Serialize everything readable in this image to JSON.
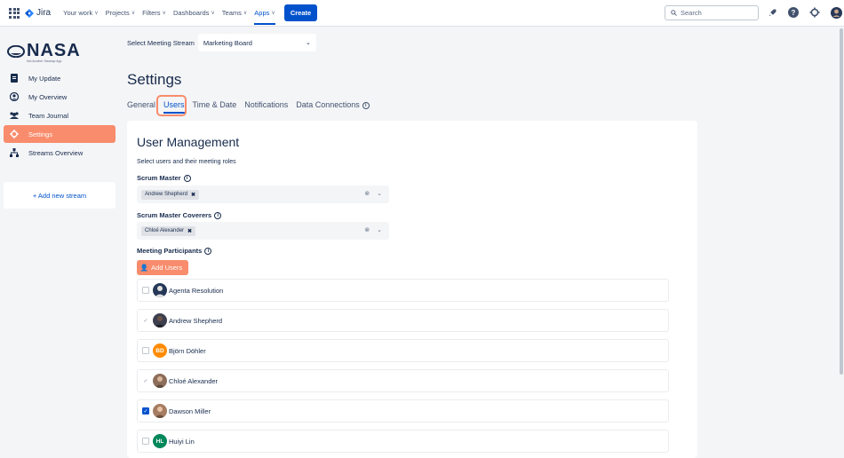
{
  "topnav": {
    "app_name": "Jira",
    "items": [
      {
        "label": "Your work"
      },
      {
        "label": "Projects"
      },
      {
        "label": "Filters"
      },
      {
        "label": "Dashboards"
      },
      {
        "label": "Teams"
      },
      {
        "label": "Apps"
      }
    ],
    "active_item": "Apps",
    "create_label": "Create",
    "search_placeholder": "Search"
  },
  "sidebar": {
    "logo": "NASA",
    "logo_sub": "Not Another Standup App",
    "items": [
      {
        "label": "My Update",
        "icon": "document-icon"
      },
      {
        "label": "My Overview",
        "icon": "person-icon"
      },
      {
        "label": "Team Journal",
        "icon": "team-icon"
      },
      {
        "label": "Settings",
        "icon": "gear-icon"
      },
      {
        "label": "Streams Overview",
        "icon": "hierarchy-icon"
      }
    ],
    "active_item": "Settings",
    "add_stream_label": "+ Add new stream"
  },
  "stream_selector": {
    "label": "Select Meeting Stream",
    "value": "Marketing Board"
  },
  "page_title": "Settings",
  "tabs": [
    {
      "label": "General"
    },
    {
      "label": "Users"
    },
    {
      "label": "Time & Date"
    },
    {
      "label": "Notifications"
    },
    {
      "label": "Data Connections"
    }
  ],
  "active_tab": "Users",
  "user_management": {
    "title": "User Management",
    "subtitle": "Select users and their meeting roles",
    "scrum_master_label": "Scrum Master",
    "scrum_master_value": "Andrew Shepherd",
    "coverers_label": "Scrum Master Coverers",
    "coverers_value": "Chloé Alexander",
    "participants_label": "Meeting Participants",
    "add_users_label": "Add Users",
    "users": [
      {
        "name": "Agenta Resolution",
        "state": "unchecked",
        "initials": "",
        "avatar_color": "#253858"
      },
      {
        "name": "Andrew Shepherd",
        "state": "tick",
        "initials": "",
        "avatar_color": "#3d3f4f"
      },
      {
        "name": "Björn Döhler",
        "state": "unchecked",
        "initials": "BD",
        "avatar_color": "#ff8b00"
      },
      {
        "name": "Chloé Alexander",
        "state": "tick",
        "initials": "",
        "avatar_color": "#8c6d5a"
      },
      {
        "name": "Dawson Miller",
        "state": "checked",
        "initials": "",
        "avatar_color": "#a67c62"
      },
      {
        "name": "Huiyi Lin",
        "state": "unchecked",
        "initials": "HL",
        "avatar_color": "#00875a"
      }
    ]
  },
  "colors": {
    "accent": "#f88c6c",
    "brand_blue": "#0052cc"
  }
}
